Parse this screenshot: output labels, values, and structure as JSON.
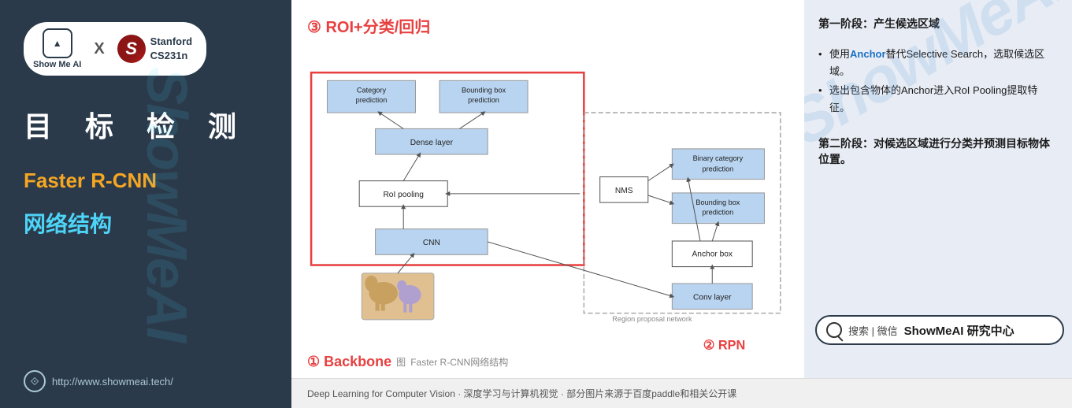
{
  "sidebar": {
    "logo_showme": "Show Me AI",
    "logo_x": "X",
    "stanford_text": "Stanford\nCS231n",
    "main_title": "目 标 检 测",
    "subtitle1": "Faster R-CNN",
    "subtitle2": "网络结构",
    "footer_url": "http://www.showmeai.tech/",
    "watermark": "ShowMeAI"
  },
  "diagram": {
    "roi_label": "③ ROI+分类/回归",
    "rpn_label": "② RPN",
    "backbone_label": "① Backbone",
    "caption_icon": "图",
    "caption_text": "Faster R-CNN网络结构",
    "region_proposal_text": "Region proposal network",
    "nodes": {
      "category_prediction": "Category\nprediction",
      "bounding_box_prediction": "Bounding box\nprediction",
      "dense_layer": "Dense layer",
      "roi_pooling": "RoI pooling",
      "nms": "NMS",
      "binary_category": "Binary category\nprediction",
      "bounding_box_pred2": "Bounding box\nprediction",
      "anchor_box": "Anchor box",
      "cnn": "CNN",
      "conv_layer": "Conv layer"
    }
  },
  "right_panel": {
    "stage1_title": "第一阶段：产生候选区域",
    "bullet1": "使用Anchor替代Selective Search，选取候选区域。",
    "bullet2": "选出包含物体的Anchor进入RoI Pooling提取特征。",
    "stage2_title": "第二阶段：对候选区域进行分类并预测目标物体位置。",
    "watermark": "ShowMeAI",
    "search_text": "搜索 | 微信",
    "search_brand": "ShowMeAI 研究中心"
  },
  "bottom_bar": {
    "text": "Deep Learning for Computer Vision · 深度学习与计算机视觉 · 部分图片来源于百度paddle和相关公开课"
  }
}
